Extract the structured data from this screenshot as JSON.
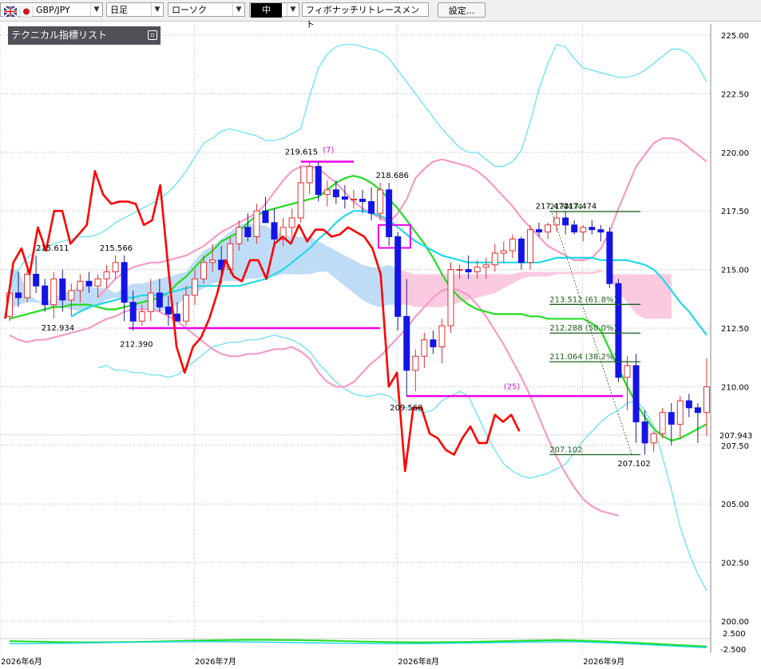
{
  "toolbar": {
    "symbol": "GBP/JPY",
    "timeframe": "日足",
    "chart_type": "ローソク",
    "drawing_mode": "中",
    "tool": "フィボナッチリトレースメント",
    "settings_label": "設定..."
  },
  "indicator_panel": {
    "title": "テクニカル指標リスト"
  },
  "colors": {
    "bull_candle": "#e03030",
    "bear_candle": "#1414e6",
    "close_line": "#ff0000",
    "bb_outer": "#5ee0f5",
    "bb_inner": "#f59bc8",
    "ma_fast": "#22dd22",
    "ma_slow": "#22d8e8",
    "cloud_bull": "#b8d8f5",
    "cloud_bear": "#fbc4de",
    "horizontal": "#ee00ee",
    "fib": "#1d5e1d"
  },
  "chart_data": {
    "type": "candlestick",
    "y_ticks": [
      "225.00",
      "222.50",
      "220.00",
      "217.50",
      "215.00",
      "212.50",
      "210.00",
      "207.50",
      "205.00",
      "202.50",
      "200.00"
    ],
    "ylim": [
      199.5,
      226.0
    ],
    "x_labels": [
      {
        "label": "2026年6月",
        "index": 0
      },
      {
        "label": "2026年7月",
        "index": 22
      },
      {
        "label": "2026年8月",
        "index": 45
      },
      {
        "label": "2026年9月",
        "index": 66
      }
    ],
    "current_price": "207.943",
    "candles": [
      [
        213.0,
        214.2,
        212.8,
        214.0
      ],
      [
        214.0,
        214.9,
        213.4,
        213.8
      ],
      [
        213.8,
        215.0,
        213.6,
        214.8
      ],
      [
        214.8,
        215.6,
        214.0,
        214.3
      ],
      [
        214.3,
        214.6,
        213.2,
        213.5
      ],
      [
        213.5,
        214.9,
        212.9,
        214.6
      ],
      [
        214.6,
        215.0,
        213.2,
        213.7
      ],
      [
        213.7,
        214.4,
        213.0,
        214.1
      ],
      [
        214.1,
        214.8,
        213.6,
        214.5
      ],
      [
        214.5,
        214.9,
        214.0,
        214.3
      ],
      [
        214.3,
        214.8,
        213.8,
        214.6
      ],
      [
        214.6,
        215.2,
        214.2,
        214.9
      ],
      [
        214.9,
        215.6,
        214.6,
        215.3
      ],
      [
        215.3,
        215.6,
        212.8,
        213.6
      ],
      [
        213.6,
        214.1,
        212.4,
        212.8
      ],
      [
        212.8,
        213.5,
        212.6,
        213.2
      ],
      [
        213.2,
        214.6,
        212.8,
        214.0
      ],
      [
        214.0,
        214.6,
        213.2,
        213.4
      ],
      [
        213.4,
        213.9,
        212.6,
        213.1
      ],
      [
        213.1,
        213.6,
        212.8,
        212.8
      ],
      [
        212.8,
        214.3,
        212.6,
        213.9
      ],
      [
        213.9,
        215.0,
        213.5,
        214.6
      ],
      [
        214.6,
        215.6,
        214.4,
        215.3
      ],
      [
        215.3,
        216.1,
        214.9,
        215.4
      ],
      [
        215.4,
        216.0,
        214.4,
        215.0
      ],
      [
        215.0,
        216.4,
        214.8,
        216.1
      ],
      [
        216.1,
        217.1,
        215.8,
        216.8
      ],
      [
        216.8,
        217.4,
        216.2,
        216.4
      ],
      [
        216.4,
        217.8,
        216.1,
        217.5
      ],
      [
        217.5,
        218.1,
        217.2,
        217.0
      ],
      [
        217.0,
        217.6,
        216.1,
        216.3
      ],
      [
        216.3,
        217.2,
        216.0,
        216.8
      ],
      [
        216.8,
        217.6,
        216.4,
        217.2
      ],
      [
        217.2,
        219.4,
        217.0,
        218.7
      ],
      [
        218.7,
        219.6,
        218.2,
        219.4
      ],
      [
        219.4,
        219.6,
        217.9,
        218.2
      ],
      [
        218.2,
        218.8,
        217.7,
        218.4
      ],
      [
        218.4,
        218.8,
        217.8,
        218.1
      ],
      [
        218.1,
        218.6,
        217.6,
        218.0
      ],
      [
        218.0,
        218.4,
        217.6,
        218.0
      ],
      [
        218.0,
        218.4,
        217.4,
        217.9
      ],
      [
        217.9,
        218.5,
        217.1,
        217.4
      ],
      [
        217.4,
        218.7,
        217.1,
        218.4
      ],
      [
        218.4,
        218.7,
        216.0,
        216.4
      ],
      [
        216.4,
        216.6,
        212.4,
        213.0
      ],
      [
        213.0,
        214.6,
        209.6,
        210.7
      ],
      [
        210.7,
        211.6,
        209.8,
        211.3
      ],
      [
        211.3,
        212.3,
        210.8,
        212.0
      ],
      [
        212.0,
        212.4,
        211.4,
        211.7
      ],
      [
        211.7,
        212.9,
        211.0,
        212.6
      ],
      [
        212.6,
        215.3,
        212.3,
        215.0
      ],
      [
        215.0,
        215.2,
        214.6,
        215.0
      ],
      [
        215.0,
        215.6,
        214.6,
        214.9
      ],
      [
        214.9,
        215.4,
        214.6,
        215.1
      ],
      [
        215.1,
        215.5,
        214.6,
        215.2
      ],
      [
        215.2,
        216.1,
        214.9,
        215.7
      ],
      [
        215.7,
        216.2,
        215.3,
        215.8
      ],
      [
        215.8,
        216.5,
        215.5,
        216.3
      ],
      [
        216.3,
        216.4,
        215.0,
        215.3
      ],
      [
        215.3,
        216.9,
        215.0,
        216.7
      ],
      [
        216.7,
        217.0,
        216.4,
        216.6
      ],
      [
        216.6,
        217.0,
        216.3,
        216.9
      ],
      [
        216.9,
        217.5,
        216.6,
        217.2
      ],
      [
        217.2,
        217.5,
        216.5,
        216.9
      ],
      [
        216.9,
        217.1,
        216.5,
        216.6
      ],
      [
        216.6,
        216.9,
        216.2,
        216.8
      ],
      [
        216.8,
        217.1,
        216.5,
        216.7
      ],
      [
        216.7,
        216.9,
        216.2,
        216.6
      ],
      [
        216.6,
        216.8,
        214.2,
        214.4
      ],
      [
        214.4,
        214.6,
        210.2,
        210.4
      ],
      [
        210.4,
        211.3,
        209.0,
        210.9
      ],
      [
        210.9,
        211.4,
        207.6,
        208.5
      ],
      [
        208.5,
        209.0,
        207.1,
        207.6
      ],
      [
        207.6,
        208.1,
        207.2,
        208.0
      ],
      [
        208.0,
        209.1,
        207.8,
        208.9
      ],
      [
        208.9,
        209.3,
        207.5,
        208.4
      ],
      [
        208.4,
        209.6,
        207.8,
        209.4
      ],
      [
        209.4,
        209.7,
        208.7,
        209.1
      ],
      [
        209.1,
        209.3,
        207.6,
        208.9
      ],
      [
        208.9,
        211.2,
        207.9,
        210.0
      ]
    ],
    "close_line_values": [
      212.9,
      215.3,
      215.9,
      214.8,
      216.8,
      215.8,
      217.5,
      217.5,
      216.1,
      216.5,
      216.9,
      219.2,
      218.2,
      217.8,
      217.9,
      217.9,
      217.8,
      216.9,
      217.1,
      218.6,
      215.0,
      211.7,
      210.6,
      211.7,
      212.1,
      212.9,
      214.0,
      215.4,
      214.7,
      214.5,
      215.4,
      215.4,
      214.6,
      216.1,
      216.4,
      216.1,
      216.9,
      216.2,
      216.7,
      216.7,
      216.4,
      216.5,
      216.8,
      216.6,
      216.4,
      215.9,
      214.8,
      210.0,
      210.6,
      206.4,
      209.1,
      209.1,
      208.0,
      207.8,
      207.3,
      207.1,
      207.8,
      208.3,
      207.6,
      207.6,
      208.8,
      208.5,
      208.8,
      208.1
    ],
    "bb_upper_outer": [
      214.2,
      215.0,
      215.5,
      215.8,
      215.9,
      216.1,
      216.2,
      216.3,
      216.4,
      216.4,
      216.5,
      216.7,
      217.0,
      217.2,
      217.4,
      217.6,
      217.8,
      218.0,
      218.3,
      218.7,
      219.2,
      219.8,
      220.4,
      220.6,
      220.9,
      221.0,
      220.9,
      220.8,
      220.7,
      220.5,
      220.5,
      220.6,
      220.8,
      221.0,
      222.4,
      223.6,
      224.2,
      224.5,
      224.6,
      224.6,
      224.5,
      224.4,
      224.3,
      224.0,
      223.5,
      223.0,
      222.5,
      222.0,
      221.5,
      221.0,
      220.6,
      220.2,
      220.0,
      220.0,
      219.7,
      219.4,
      219.4,
      219.6,
      220.1,
      221.3,
      222.7,
      223.8,
      224.6,
      224.5,
      224.0,
      223.6,
      223.5,
      223.4,
      223.3,
      223.2,
      223.2,
      223.3,
      223.5,
      223.8,
      224.1,
      224.4,
      224.4,
      224.2,
      223.7,
      223.0
    ],
    "bb_lower_outer": [
      210.8,
      210.9,
      210.7,
      210.7,
      210.6,
      210.6,
      210.5,
      210.5,
      210.4,
      210.5,
      210.8,
      211.1,
      211.4,
      211.7,
      211.8,
      211.9,
      211.9,
      212.0,
      212.0,
      212.1,
      212.2,
      212.1,
      212.0,
      211.8,
      211.5,
      211.0,
      210.6,
      210.2,
      209.9,
      209.7,
      209.6,
      209.6,
      209.7,
      209.6,
      209.3,
      209.1,
      209.0,
      208.9,
      209.0,
      209.4,
      209.6,
      209.8,
      209.6,
      208.8,
      208.0,
      207.3,
      206.7,
      206.4,
      206.2,
      206.1,
      206.2,
      206.3,
      206.5,
      206.7,
      207.2,
      207.7,
      208.1,
      208.5,
      208.8,
      209.0,
      209.3,
      209.4,
      209.0,
      208.3,
      207.0,
      205.6,
      204.0,
      202.9,
      202.0,
      201.3
    ],
    "bb_upper_inner": [
      213.8,
      214.2,
      214.6,
      214.9,
      215.1,
      215.2,
      215.3,
      215.3,
      215.4,
      215.5,
      215.6,
      215.8,
      216.0,
      216.3,
      216.6,
      216.8,
      217.0,
      217.2,
      217.4,
      217.8,
      218.3,
      218.8,
      219.2,
      219.4,
      219.4,
      219.3,
      219.0,
      218.7,
      218.3,
      217.9,
      217.6,
      217.4,
      217.2,
      217.0,
      217.4,
      218.0,
      218.9,
      219.3,
      219.6,
      219.7,
      219.6,
      219.5,
      219.4,
      219.2,
      218.9,
      218.5,
      218.1,
      217.7,
      217.2,
      216.8,
      216.4,
      216.0,
      215.8,
      215.6,
      215.4,
      215.4,
      215.5,
      215.9,
      216.6,
      217.6,
      218.5,
      219.4,
      219.9,
      220.4,
      220.6,
      220.6,
      220.5,
      220.2,
      219.9,
      219.6
    ],
    "bb_lower_inner": [
      212.2,
      212.0,
      211.9,
      212.0,
      212.0,
      212.1,
      212.2,
      212.3,
      212.4,
      212.5,
      212.7,
      212.9,
      213.0,
      213.2,
      213.3,
      213.3,
      213.3,
      213.2,
      213.0,
      212.8,
      212.5,
      212.2,
      211.9,
      211.6,
      211.4,
      211.3,
      211.3,
      211.4,
      211.4,
      211.5,
      211.6,
      211.6,
      211.7,
      211.5,
      211.2,
      210.6,
      210.2,
      210.0,
      210.0,
      210.2,
      210.6,
      211.0,
      211.3,
      211.7,
      212.1,
      212.5,
      213.0,
      213.4,
      213.8,
      214.1,
      214.2,
      214.1,
      213.9,
      213.5,
      213.0,
      212.4,
      211.8,
      211.1,
      210.4,
      209.6,
      208.7,
      207.8,
      207.0,
      206.3,
      205.7,
      205.2,
      204.9,
      204.7,
      204.6,
      204.5
    ],
    "ma_green": [
      212.9,
      213.0,
      213.1,
      213.2,
      213.3,
      213.4,
      213.4,
      213.5,
      213.5,
      213.5,
      213.4,
      213.3,
      213.3,
      213.4,
      213.5,
      213.6,
      213.7,
      213.8,
      214.0,
      214.4,
      214.7,
      215.1,
      215.5,
      215.8,
      216.2,
      216.4,
      216.6,
      217.0,
      217.3,
      217.5,
      217.6,
      217.7,
      217.8,
      217.9,
      218.0,
      218.1,
      218.4,
      218.7,
      218.9,
      219.0,
      218.9,
      218.7,
      218.4,
      218.0,
      217.6,
      217.1,
      216.6,
      216.1,
      215.5,
      214.8,
      214.2,
      213.8,
      213.5,
      213.3,
      213.2,
      213.1,
      213.1,
      213.1,
      213.1,
      213.0,
      213.0,
      212.9,
      212.9,
      212.9,
      212.9,
      212.9,
      212.7,
      212.4,
      211.6,
      210.8,
      210.0,
      209.3,
      208.7,
      208.2,
      207.9,
      207.7,
      207.8,
      208.0,
      208.2,
      208.4
    ],
    "ma_cyan": [
      213.0,
      213.2,
      213.4,
      213.5,
      213.6,
      213.7,
      213.8,
      213.8,
      213.9,
      213.9,
      213.9,
      214.0,
      214.1,
      214.2,
      214.3,
      214.3,
      214.3,
      214.3,
      214.3,
      214.3,
      214.4,
      214.5,
      214.6,
      214.8,
      215.0,
      215.3,
      215.6,
      215.9,
      216.3,
      216.6,
      217.0,
      217.3,
      217.5,
      217.5,
      217.4,
      217.3,
      217.1,
      216.8,
      216.5,
      216.2,
      216.0,
      215.8,
      215.6,
      215.5,
      215.4,
      215.3,
      215.3,
      215.3,
      215.3,
      215.3,
      215.3,
      215.3,
      215.3,
      215.3,
      215.4,
      215.5,
      215.5,
      215.5,
      215.5,
      215.5,
      215.4,
      215.4,
      215.4,
      215.4,
      215.3,
      215.2,
      215.0,
      214.6,
      214.1,
      213.6,
      213.2,
      212.7,
      212.2
    ]
  },
  "annotations": {
    "high_labels": [
      "219.615",
      "218.686",
      "217.474",
      "217.474",
      "215.611",
      "215.566"
    ],
    "low_labels": [
      "212.934",
      "212.390",
      "209.568",
      "207.102"
    ],
    "count_labels": [
      "(7)",
      "(25)"
    ],
    "fib_levels": [
      {
        "price": "217.474",
        "label": "217.474"
      },
      {
        "price": "213.512",
        "label": "213.512 (61.8%)"
      },
      {
        "price": "212.288",
        "label": "212.288 (50.0%)"
      },
      {
        "price": "211.064",
        "label": "211.064 (38.2%)"
      },
      {
        "price": "207.102",
        "label": "207.102"
      }
    ],
    "oscillator_ticks": [
      "2.500",
      "-2.500"
    ]
  }
}
